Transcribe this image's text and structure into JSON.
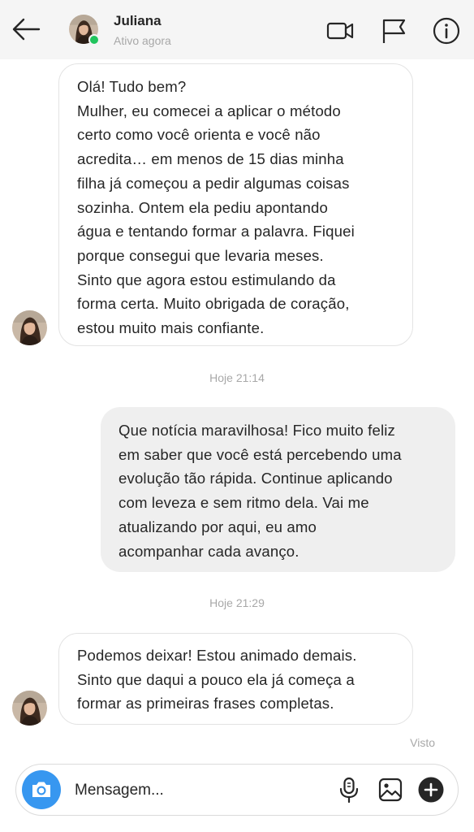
{
  "header": {
    "contact_name": "Juliana",
    "status": "Ativo agora",
    "icons": [
      "back-arrow-icon",
      "video-call-icon",
      "flag-icon",
      "info-icon"
    ]
  },
  "messages": [
    {
      "direction": "incoming",
      "text": "Olá! Tudo bem?\nMulher, eu comecei a aplicar o método\ncerto como você orienta e você não\nacredita… em menos de 15 dias minha\nfilha já começou a pedir algumas coisas\nsozinha. Ontem ela pediu apontando\nágua e tentando formar a palavra. Fiquei\nporque consegui que levaria meses.\nSinto que agora estou estimulando da\nforma certa. Muito obrigada de coração,\nestou muito mais confiante."
    },
    {
      "direction": "timestamp",
      "text": "Hoje 21:14"
    },
    {
      "direction": "outgoing",
      "text": "Que notícia maravilhosa! Fico muito feliz\nem saber que você está percebendo uma\nevolução tão rápida. Continue aplicando\ncom leveza e sem ritmo dela. Vai me\natualizando por aqui, eu amo\nacompanhar cada avanço."
    },
    {
      "direction": "timestamp",
      "text": "Hoje 21:29"
    },
    {
      "direction": "incoming",
      "text": "Podemos deixar! Estou animado demais.\nSinto que daqui a pouco ela já começa a\nformar as primeiras frases completas."
    }
  ],
  "seen_label": "Visto",
  "composer": {
    "placeholder": "Mensagem...",
    "icons": [
      "camera-icon",
      "microphone-icon",
      "gallery-icon",
      "plus-icon"
    ]
  },
  "colors": {
    "header_bg": "#f5f5f5",
    "incoming_bubble": "#ffffff",
    "outgoing_bubble": "#efefef",
    "online": "#21c45d",
    "camera_button": "#3797f0",
    "muted_text": "#a8a8a8"
  }
}
